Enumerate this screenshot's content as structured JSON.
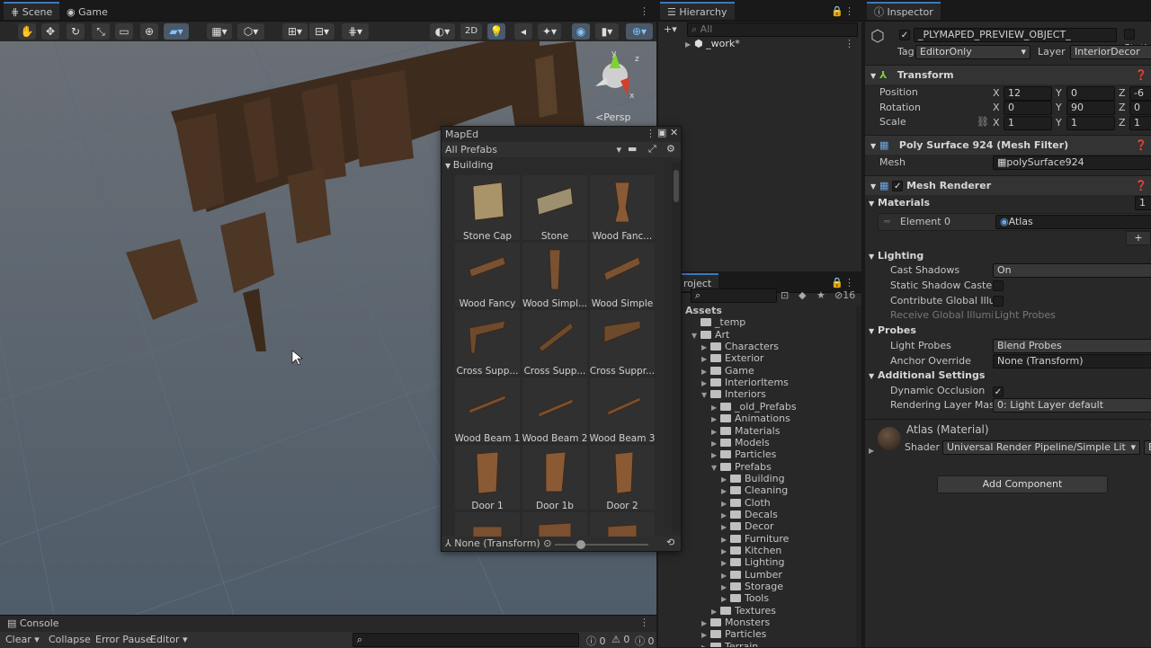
{
  "scene": {
    "tabs": [
      "Scene",
      "Game"
    ],
    "btn_2d": "2D",
    "persp_label": "<Persp",
    "gizmo_axes": [
      "y",
      "x",
      "z"
    ]
  },
  "console": {
    "tab": "Console",
    "clear": "Clear",
    "collapse": "Collapse",
    "error_pause": "Error Pause",
    "editor": "Editor",
    "counts": [
      "0",
      "0",
      "0"
    ]
  },
  "hierarchy": {
    "tab": "Hierarchy",
    "search_placeholder": "All",
    "root": "_work*"
  },
  "project": {
    "tab": "roject",
    "badge": "16",
    "tree": [
      {
        "label": "Assets",
        "indent": 0,
        "type": "root"
      },
      {
        "label": "_temp",
        "indent": 1,
        "type": "leaf"
      },
      {
        "label": "Art",
        "indent": 1,
        "type": "open"
      },
      {
        "label": "Characters",
        "indent": 2,
        "type": "closed"
      },
      {
        "label": "Exterior",
        "indent": 2,
        "type": "closed"
      },
      {
        "label": "Game",
        "indent": 2,
        "type": "closed"
      },
      {
        "label": "InteriorItems",
        "indent": 2,
        "type": "closed"
      },
      {
        "label": "Interiors",
        "indent": 2,
        "type": "open"
      },
      {
        "label": "_old_Prefabs",
        "indent": 3,
        "type": "closed"
      },
      {
        "label": "Animations",
        "indent": 3,
        "type": "closed"
      },
      {
        "label": "Materials",
        "indent": 3,
        "type": "closed"
      },
      {
        "label": "Models",
        "indent": 3,
        "type": "closed"
      },
      {
        "label": "Particles",
        "indent": 3,
        "type": "closed"
      },
      {
        "label": "Prefabs",
        "indent": 3,
        "type": "open"
      },
      {
        "label": "Building",
        "indent": 4,
        "type": "closed"
      },
      {
        "label": "Cleaning",
        "indent": 4,
        "type": "closed"
      },
      {
        "label": "Cloth",
        "indent": 4,
        "type": "closed"
      },
      {
        "label": "Decals",
        "indent": 4,
        "type": "closed"
      },
      {
        "label": "Decor",
        "indent": 4,
        "type": "closed"
      },
      {
        "label": "Furniture",
        "indent": 4,
        "type": "closed"
      },
      {
        "label": "Kitchen",
        "indent": 4,
        "type": "closed"
      },
      {
        "label": "Lighting",
        "indent": 4,
        "type": "closed"
      },
      {
        "label": "Lumber",
        "indent": 4,
        "type": "closed"
      },
      {
        "label": "Storage",
        "indent": 4,
        "type": "closed"
      },
      {
        "label": "Tools",
        "indent": 4,
        "type": "closed"
      },
      {
        "label": "Textures",
        "indent": 3,
        "type": "closed"
      },
      {
        "label": "Monsters",
        "indent": 2,
        "type": "closed"
      },
      {
        "label": "Particles",
        "indent": 2,
        "type": "closed"
      },
      {
        "label": "Terrain",
        "indent": 2,
        "type": "closed"
      }
    ]
  },
  "maped": {
    "title": "MapEd",
    "filter": "All Prefabs",
    "section": "Building",
    "footer": "None (Transform)",
    "items": [
      {
        "label": "Stone Cap",
        "color": "#a89468"
      },
      {
        "label": "Stone",
        "color": "#9c9070"
      },
      {
        "label": "Wood Fanc...",
        "color": "#8a5a36"
      },
      {
        "label": "Wood Fancy",
        "color": "#7a5232"
      },
      {
        "label": "Wood Simpl...",
        "color": "#7a5232"
      },
      {
        "label": "Wood Simple",
        "color": "#7a5232"
      },
      {
        "label": "Cross Supp...",
        "color": "#6e4a2c"
      },
      {
        "label": "Cross Supp...",
        "color": "#6e4a2c"
      },
      {
        "label": "Cross Suppr...",
        "color": "#6e4a2c"
      },
      {
        "label": "Wood Beam 1",
        "color": "#7a5030"
      },
      {
        "label": "Wood Beam 2",
        "color": "#7a5030"
      },
      {
        "label": "Wood Beam 3",
        "color": "#7a5030"
      },
      {
        "label": "Door 1",
        "color": "#8a5a34"
      },
      {
        "label": "Door 1b",
        "color": "#8a5a34"
      },
      {
        "label": "Door 2",
        "color": "#8a5a34"
      },
      {
        "label": "",
        "color": "#7a5030"
      },
      {
        "label": "",
        "color": "#7a5030"
      },
      {
        "label": "",
        "color": "#7a5030"
      }
    ]
  },
  "inspector": {
    "tab": "Inspector",
    "object_name": "_PLYMAPED_PREVIEW_OBJECT_",
    "static": "Stati",
    "tag_label": "Tag",
    "tag": "EditorOnly",
    "layer_label": "Layer",
    "layer": "InteriorDecor",
    "transform": {
      "title": "Transform",
      "position_label": "Position",
      "rotation_label": "Rotation",
      "scale_label": "Scale",
      "position": [
        "12",
        "0",
        "-6"
      ],
      "rotation": [
        "0",
        "90",
        "0"
      ],
      "scale": [
        "1",
        "1",
        "1"
      ]
    },
    "mesh_filter": {
      "title": "Poly Surface 924 (Mesh Filter)",
      "mesh_label": "Mesh",
      "mesh": "polySurface924"
    },
    "mesh_renderer": {
      "title": "Mesh Renderer",
      "materials": "Materials",
      "materials_count": "1",
      "element_label": "Element 0",
      "element": "Atlas",
      "lighting": "Lighting",
      "cast_shadows_label": "Cast Shadows",
      "cast_shadows": "On",
      "static_caster": "Static Shadow Caster",
      "contribute_gi": "Contribute Global Illumi",
      "receive_gi": "Receive Global Illumina",
      "receive_gi_value": "Light Probes",
      "probes": "Probes",
      "light_probes_label": "Light Probes",
      "light_probes": "Blend Probes",
      "anchor_label": "Anchor Override",
      "anchor": "None (Transform)",
      "additional": "Additional Settings",
      "dynamic_occlusion": "Dynamic Occlusion",
      "rendering_layer_label": "Rendering Layer Mask",
      "rendering_layer": "0: Light Layer default"
    },
    "material": {
      "title": "Atlas (Material)",
      "shader_label": "Shader",
      "shader": "Universal Render Pipeline/Simple Lit",
      "e_label": "E"
    },
    "add_component": "Add Component"
  }
}
